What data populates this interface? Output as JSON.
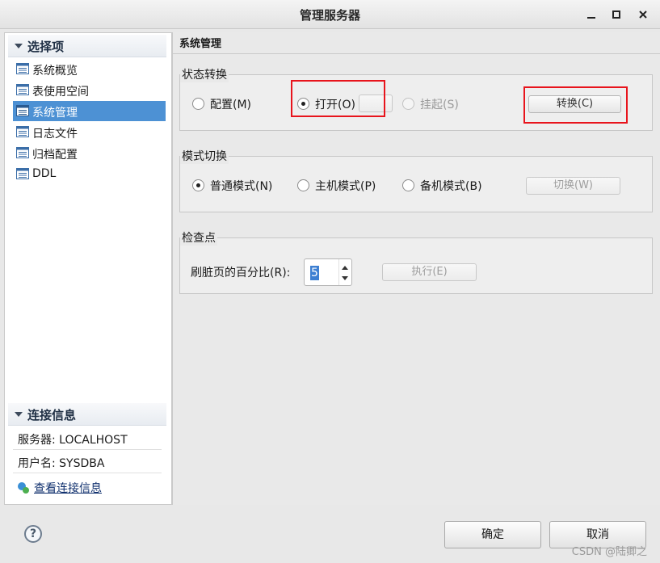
{
  "window": {
    "title": "管理服务器"
  },
  "left": {
    "options_header": "选择项",
    "nav_items": [
      {
        "label": "系统概览",
        "icon": "list-icon",
        "selected": false
      },
      {
        "label": "表使用空间",
        "icon": "list-icon",
        "selected": false
      },
      {
        "label": "系统管理",
        "icon": "list-icon",
        "selected": true
      },
      {
        "label": "日志文件",
        "icon": "list-icon",
        "selected": false
      },
      {
        "label": "归档配置",
        "icon": "list-icon",
        "selected": false
      },
      {
        "label": "DDL",
        "icon": "list-icon",
        "selected": false
      }
    ],
    "connection_header": "连接信息",
    "server_label": "服务器: LOCALHOST",
    "user_label": "用户名: SYSDBA",
    "view_link": "查看连接信息"
  },
  "main": {
    "title": "系统管理",
    "state_group": {
      "title": "状态转换",
      "options": [
        {
          "label": "配置(M)",
          "checked": false,
          "disabled": false
        },
        {
          "label": "打开(O)",
          "checked": true,
          "disabled": false
        },
        {
          "label": "挂起(S)",
          "checked": false,
          "disabled": true
        }
      ],
      "button": "转换(C)"
    },
    "mode_group": {
      "title": "模式切换",
      "options": [
        {
          "label": "普通模式(N)",
          "checked": true
        },
        {
          "label": "主机模式(P)",
          "checked": false
        },
        {
          "label": "备机模式(B)",
          "checked": false
        }
      ],
      "button": "切换(W)"
    },
    "checkpoint_group": {
      "title": "检查点",
      "label": "刷脏页的百分比(R):",
      "value": "5",
      "button": "执行(E)"
    }
  },
  "footer": {
    "help": "?",
    "ok": "确定",
    "cancel": "取消",
    "watermark": "CSDN @陆卿之"
  },
  "colors": {
    "selection": "#4d91d4",
    "highlight_box": "#e8141c",
    "link": "#10306e"
  }
}
